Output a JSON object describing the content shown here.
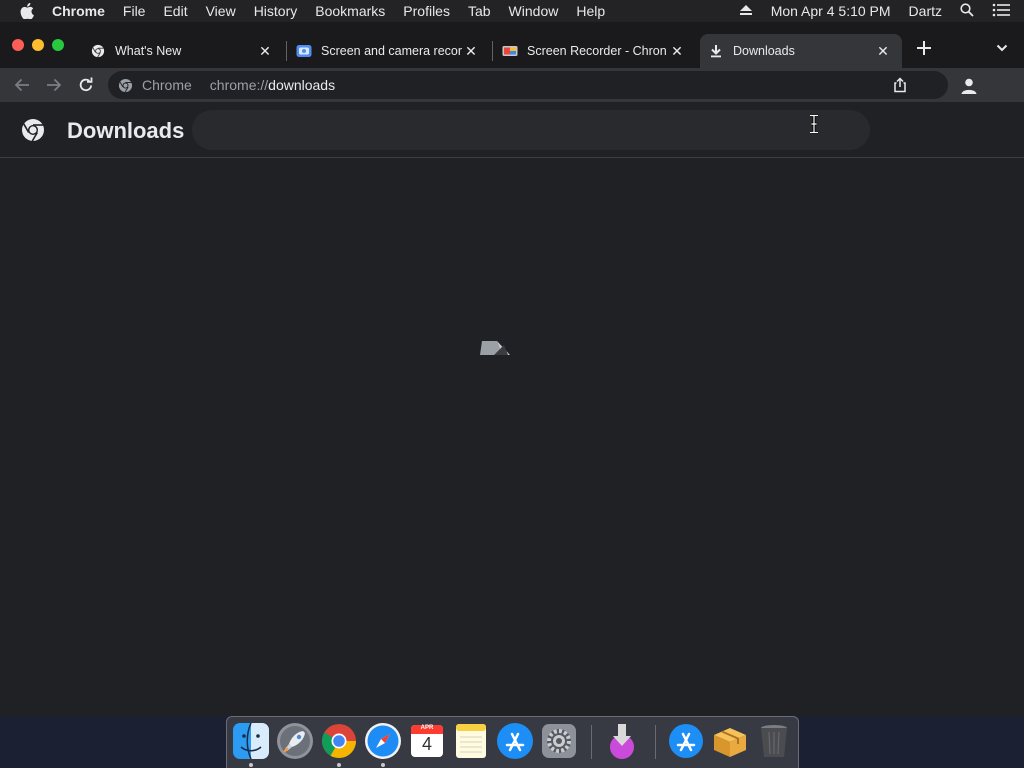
{
  "menubar": {
    "app_name": "Chrome",
    "items": [
      "File",
      "Edit",
      "View",
      "History",
      "Bookmarks",
      "Profiles",
      "Tab",
      "Window",
      "Help"
    ],
    "datetime": "Mon Apr 4  5:10 PM",
    "user": "Dartz"
  },
  "tabs": [
    {
      "title": "What's New",
      "icon": "chrome-icon",
      "active": false
    },
    {
      "title": "Screen and camera recor",
      "icon": "screen-camera-icon",
      "active": false
    },
    {
      "title": "Screen Recorder - Chron",
      "icon": "screen-recorder-extension-icon",
      "active": false
    },
    {
      "title": "Downloads",
      "icon": "download-icon",
      "active": true
    }
  ],
  "omnibox": {
    "chip": "Chrome",
    "url_scheme": "chrome://",
    "url_path": "downloads"
  },
  "page": {
    "title": "Downloads",
    "search_value": ""
  },
  "dock": {
    "calendar_month": "APR",
    "calendar_day": "4",
    "apps": [
      "Finder",
      "Launchpad",
      "Google Chrome",
      "Safari",
      "Calendar",
      "Notes",
      "App Store",
      "System Preferences",
      "Downloads",
      "App Store",
      "Archive Utility",
      "Trash"
    ]
  },
  "colors": {
    "window_bg": "#202124",
    "toolbar_bg": "#35363a",
    "tabstrip_bg": "#1a1a1c",
    "text_primary": "#e8eaed",
    "text_secondary": "#9aa0a6"
  }
}
